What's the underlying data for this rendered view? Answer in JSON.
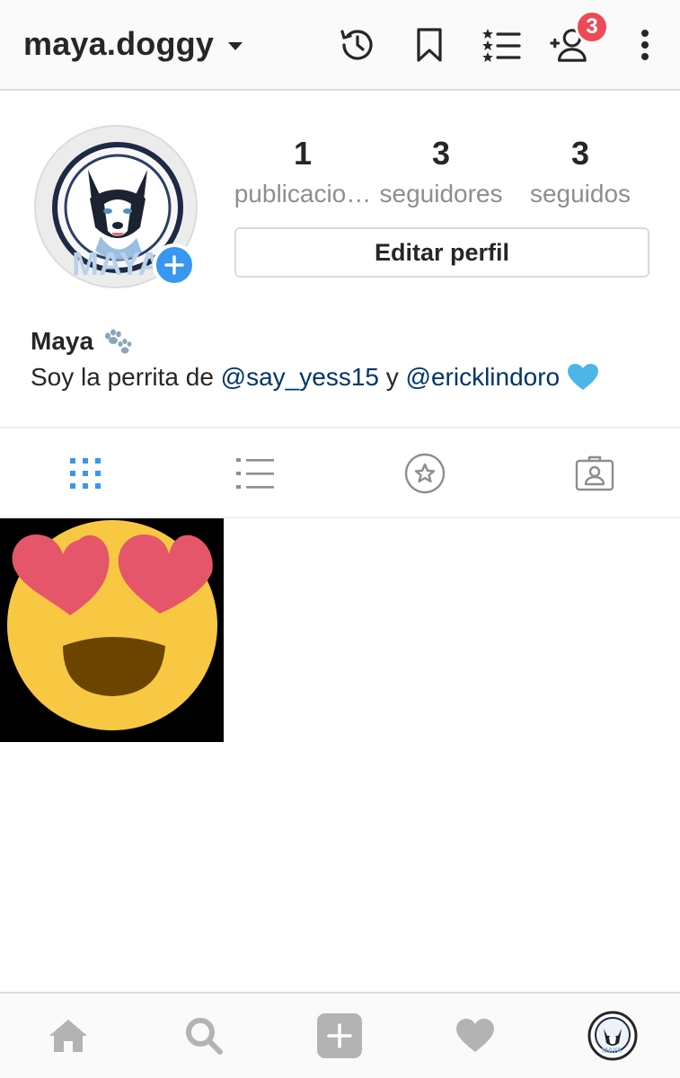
{
  "header": {
    "username": "maya.doggy",
    "notification_count": "3"
  },
  "profile": {
    "stats": [
      {
        "value": "1",
        "label": "publicacio…"
      },
      {
        "value": "3",
        "label": "seguidores"
      },
      {
        "value": "3",
        "label": "seguidos"
      }
    ],
    "edit_label": "Editar perfil",
    "avatar_text": "MAYA"
  },
  "bio": {
    "name": "Maya",
    "name_emoji": "paw-prints-icon",
    "text_prefix": "Soy la perrita de ",
    "mention_1": "@say_yess15",
    "text_middle": " y ",
    "mention_2": "@ericklindoro",
    "end_emoji": "blue-heart-icon"
  },
  "tabs": [
    {
      "name": "grid-view",
      "active": true
    },
    {
      "name": "list-view",
      "active": false
    },
    {
      "name": "saved-view",
      "active": false
    },
    {
      "name": "tagged-view",
      "active": false
    }
  ],
  "posts": [
    {
      "content": "heart-eyes-emoji"
    }
  ],
  "bottom_nav": [
    "home-icon",
    "search-icon",
    "add-post-icon",
    "activity-heart-icon",
    "profile-avatar"
  ],
  "colors": {
    "accent_blue": "#3897f0",
    "badge_red": "#ed4956",
    "mention_blue": "#003569",
    "secondary_text": "#8e8e8e"
  }
}
